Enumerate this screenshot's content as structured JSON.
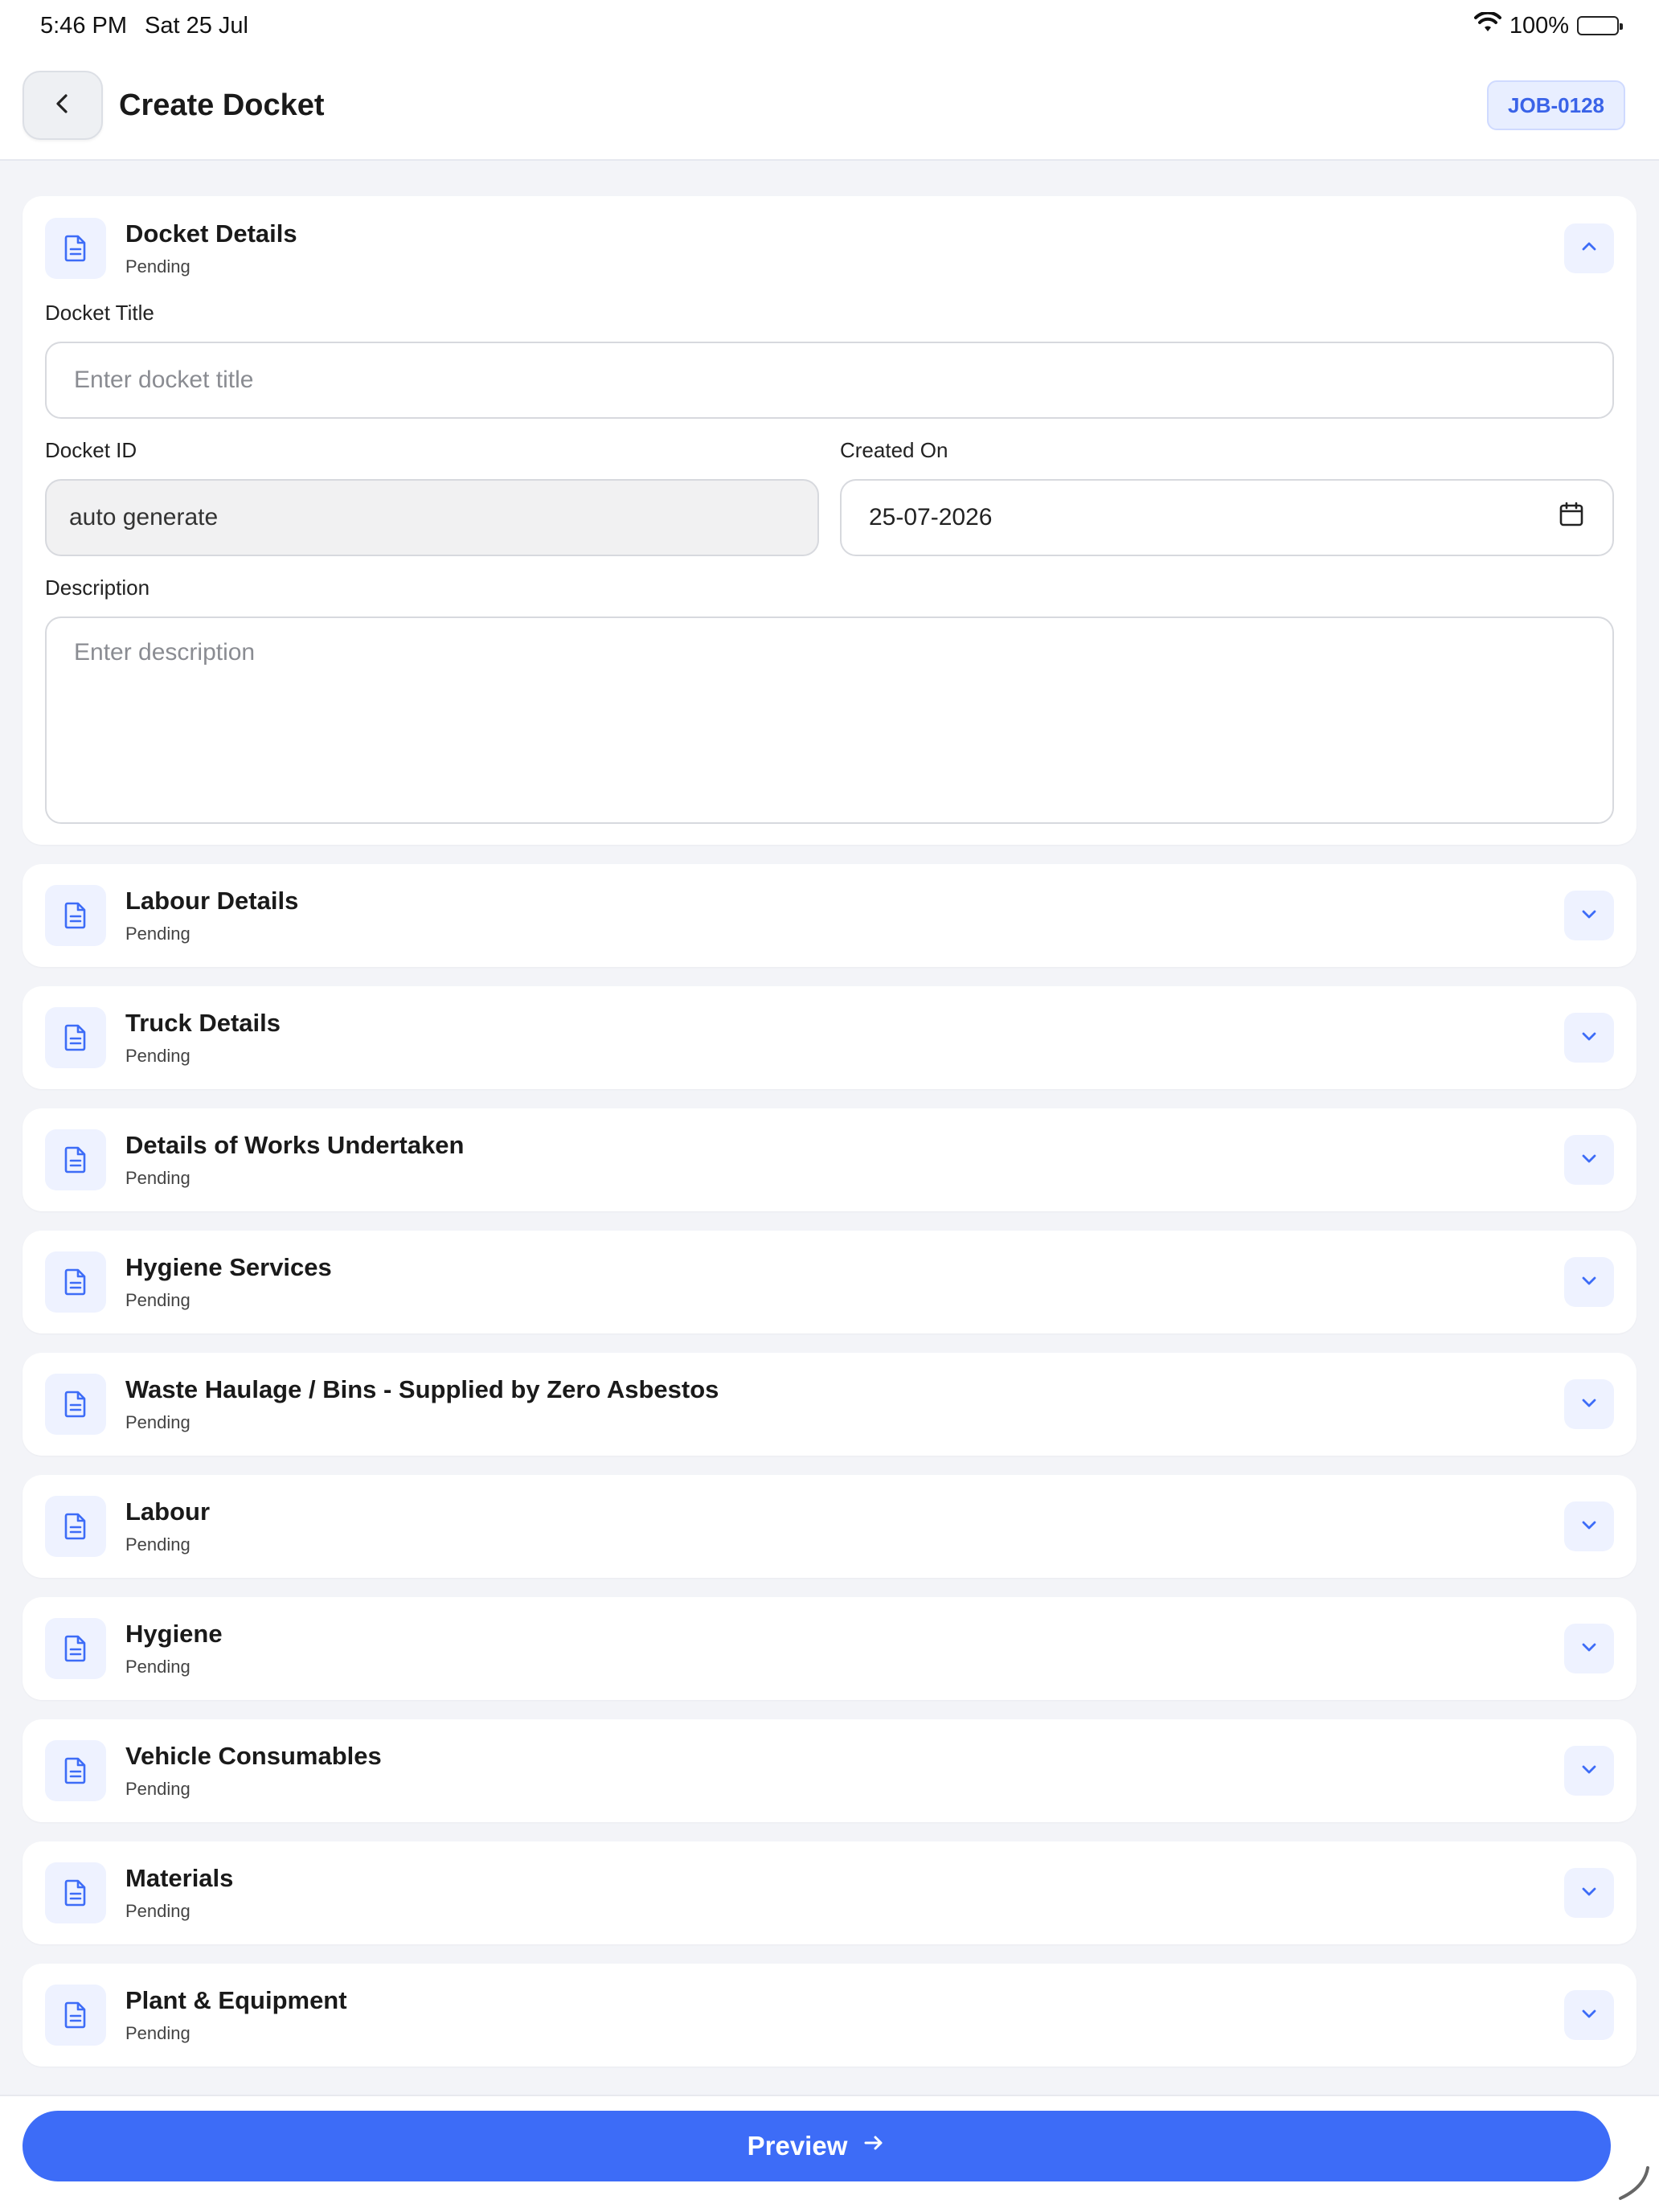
{
  "status_bar": {
    "time": "5:46 PM",
    "date": "Sat 25 Jul",
    "battery": "100%"
  },
  "header": {
    "title": "Create Docket",
    "job_id": "JOB-0128"
  },
  "docket_details": {
    "title": "Docket Details",
    "status": "Pending",
    "docket_title_label": "Docket Title",
    "docket_title_placeholder": "Enter docket title",
    "docket_id_label": "Docket ID",
    "docket_id_value": "auto generate",
    "created_on_label": "Created On",
    "created_on_value": "25-07-2026",
    "description_label": "Description",
    "description_placeholder": "Enter description"
  },
  "sections": [
    {
      "title": "Labour Details",
      "status": "Pending"
    },
    {
      "title": "Truck Details",
      "status": "Pending"
    },
    {
      "title": "Details of Works Undertaken",
      "status": "Pending"
    },
    {
      "title": "Hygiene Services",
      "status": "Pending"
    },
    {
      "title": "Waste Haulage / Bins - Supplied by Zero Asbestos",
      "status": "Pending"
    },
    {
      "title": "Labour",
      "status": "Pending"
    },
    {
      "title": "Hygiene",
      "status": "Pending"
    },
    {
      "title": "Vehicle Consumables",
      "status": "Pending"
    },
    {
      "title": "Materials",
      "status": "Pending"
    },
    {
      "title": "Plant & Equipment",
      "status": "Pending"
    }
  ],
  "footer": {
    "preview_label": "Preview"
  },
  "colors": {
    "accent": "#3d6cf7",
    "badge_bg": "#e8eeff",
    "badge_text": "#3a63e8"
  }
}
